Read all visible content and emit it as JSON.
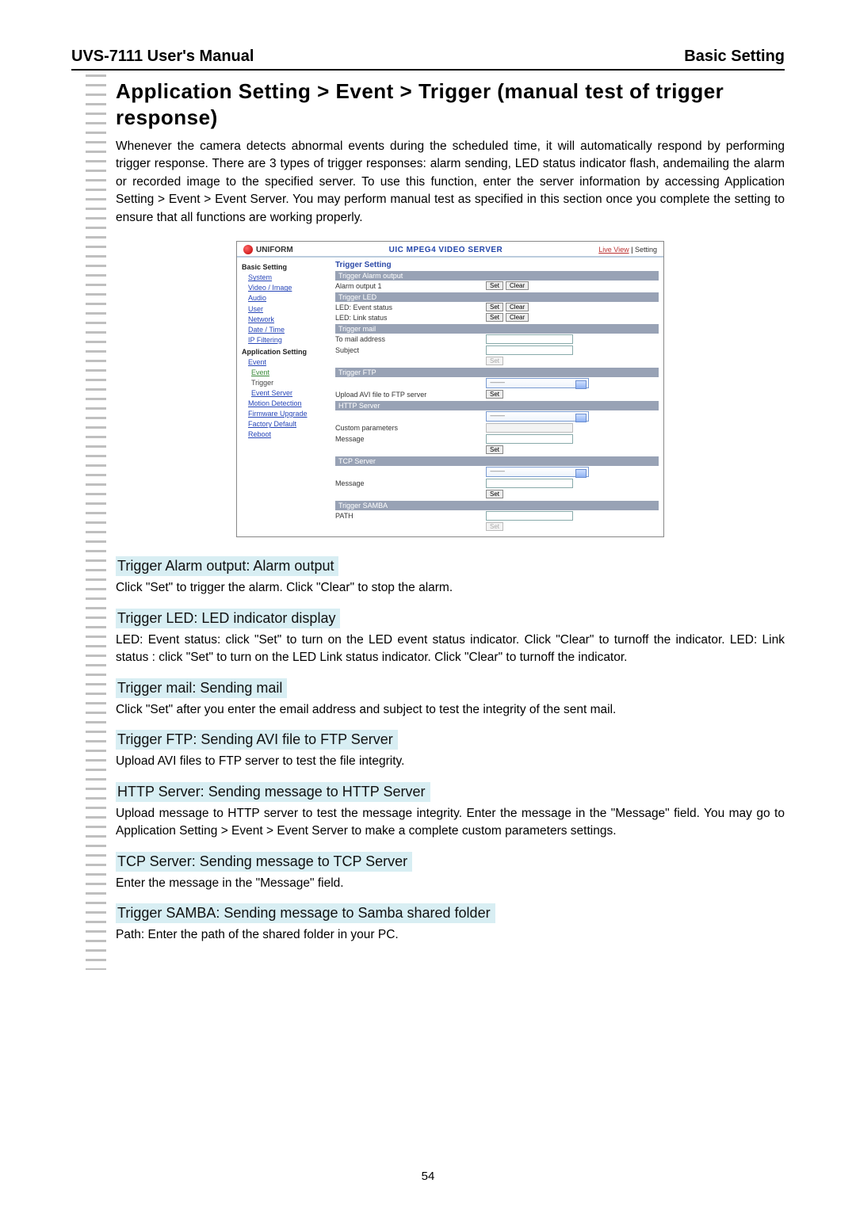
{
  "header": {
    "left": "UVS-7111 User's Manual",
    "right": "Basic Setting"
  },
  "main_title": "Application Setting > Event > Trigger (manual test of trigger response)",
  "intro": "Whenever the camera detects abnormal events during the scheduled time, it will automatically respond by performing trigger response. There are 3 types of trigger responses: alarm sending, LED status indicator flash, andemailing the alarm or recorded image to the specified server. To use this function, enter the server information by accessing Application Setting > Event > Event Server. You may perform manual test as specified in this section once you complete the setting to ensure that all functions are working properly.",
  "sections": [
    {
      "title": "Trigger Alarm output: Alarm output",
      "body": "Click \"Set\" to trigger the alarm. Click \"Clear\" to stop the alarm."
    },
    {
      "title": "Trigger LED: LED indicator display",
      "body": "LED: Event status: click \"Set\" to turn on the LED event status indicator. Click \"Clear\" to turnoff the indicator. LED: Link status : click \"Set\" to turn on the LED Link status indicator. Click \"Clear\" to turnoff the indicator."
    },
    {
      "title": "Trigger mail: Sending mail",
      "body": "Click \"Set\" after you enter the email address and subject to test the integrity of the sent mail."
    },
    {
      "title": "Trigger FTP: Sending AVI file to FTP Server",
      "body": "Upload AVI files to FTP server to test the file integrity."
    },
    {
      "title": "HTTP Server: Sending message to HTTP Server",
      "body": "Upload message to HTTP server to test the message integrity. Enter the message in the \"Message\" field. You may go to Application Setting > Event > Event Server to make a complete custom parameters settings."
    },
    {
      "title": "TCP Server: Sending message to TCP Server",
      "body": "Enter the message in the \"Message\" field."
    },
    {
      "title": "Trigger SAMBA: Sending message to Samba shared folder",
      "body": "Path: Enter the path of the shared folder in your PC."
    }
  ],
  "page_number": "54",
  "admin": {
    "brand": "UNIFORM",
    "title": "UIC MPEG4 VIDEO SERVER",
    "live_view": "Live View",
    "setting": "Setting",
    "sidebar": {
      "basic": "Basic Setting",
      "items_basic": [
        "System",
        "Video / Image",
        "Audio",
        "User",
        "Network",
        "Date / Time",
        "IP Filtering"
      ],
      "app": "Application Setting",
      "event": "Event",
      "event_sub": [
        "Event",
        "Trigger",
        "Event Server"
      ],
      "items_app": [
        "Motion Detection",
        "Firmware Upgrade",
        "Factory Default",
        "Reboot"
      ]
    },
    "panel": {
      "heading": "Trigger Setting",
      "alarm_band": "Trigger Alarm output",
      "alarm_row": "Alarm output 1",
      "led_band": "Trigger LED",
      "led_event": "LED: Event status",
      "led_link": "LED: Link status",
      "mail_band": "Trigger mail",
      "mail_to": "To mail address",
      "mail_subj": "Subject",
      "ftp_band": "Trigger FTP",
      "ftp_upload": "Upload AVI file to FTP server",
      "http_band": "HTTP Server",
      "http_custom": "Custom parameters",
      "http_msg": "Message",
      "tcp_band": "TCP Server",
      "tcp_msg": "Message",
      "samba_band": "Trigger SAMBA",
      "samba_path": "PATH",
      "set": "Set",
      "clear": "Clear"
    }
  }
}
